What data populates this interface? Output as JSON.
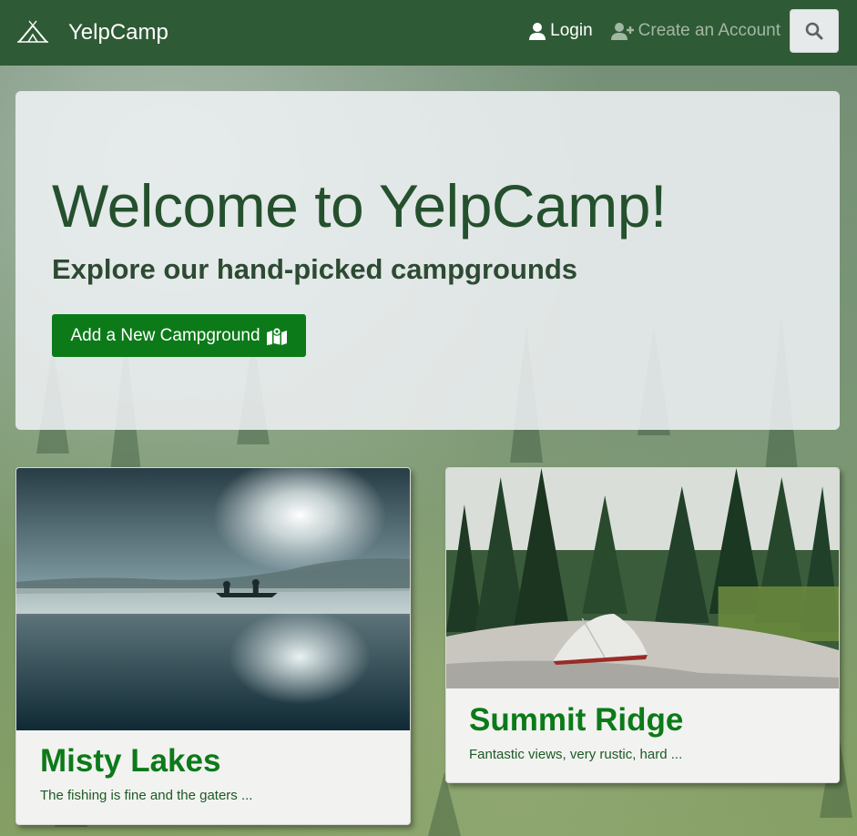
{
  "navbar": {
    "brand_name": "YelpCamp",
    "login_label": "Login",
    "register_label": "Create an Account",
    "search_icon": "search-icon"
  },
  "hero": {
    "title": "Welcome to YelpCamp!",
    "subtitle": "Explore our hand-picked campgrounds",
    "add_button_label": "Add a New Campground",
    "add_button_icon": "map-marked-icon"
  },
  "campgrounds": [
    {
      "title": "Misty Lakes",
      "description": "The fishing is fine and the gaters ...",
      "image": "misty-lake-canoe"
    },
    {
      "title": "Summit Ridge",
      "description": "Fantastic views, very rustic, hard ...",
      "image": "forest-tent"
    }
  ],
  "colors": {
    "navbar": "#2e5a35",
    "accent_green": "#0c7a18",
    "hero_title": "#25502d"
  }
}
